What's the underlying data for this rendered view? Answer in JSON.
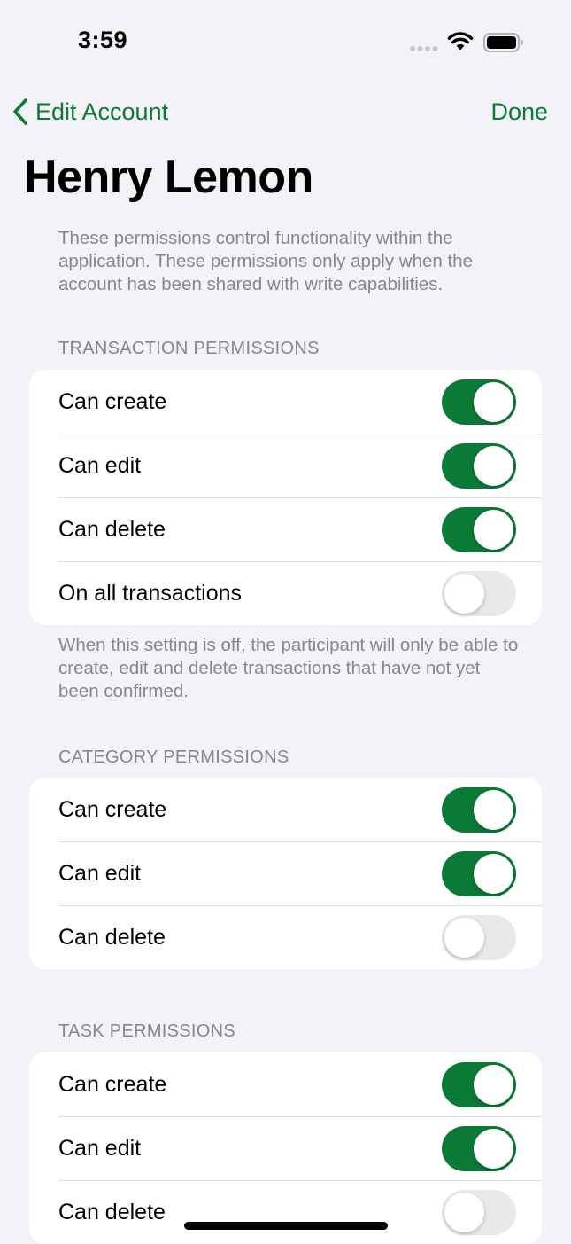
{
  "status_bar": {
    "time": "3:59",
    "icons": [
      "cellular-signal-icon",
      "wifi-icon",
      "battery-icon"
    ]
  },
  "nav": {
    "back_label": "Edit Account",
    "back_icon": "chevron-left-icon",
    "done_label": "Done",
    "accent_color": "#0b7a36"
  },
  "page": {
    "title": "Henry Lemon",
    "intro": "These permissions control functionality within the application. These permissions only apply when the account has been shared with write capabilities."
  },
  "sections": {
    "transaction": {
      "header": "TRANSACTION PERMISSIONS",
      "rows": [
        {
          "label": "Can create",
          "on": true
        },
        {
          "label": "Can edit",
          "on": true
        },
        {
          "label": "Can delete",
          "on": true
        },
        {
          "label": "On all transactions",
          "on": false
        }
      ],
      "footer": "When this setting is off, the participant will only be able to create, edit and delete transactions that have not yet been confirmed."
    },
    "category": {
      "header": "CATEGORY PERMISSIONS",
      "rows": [
        {
          "label": "Can create",
          "on": true
        },
        {
          "label": "Can edit",
          "on": true
        },
        {
          "label": "Can delete",
          "on": false
        }
      ]
    },
    "task": {
      "header": "TASK PERMISSIONS",
      "rows": [
        {
          "label": "Can create",
          "on": true
        },
        {
          "label": "Can edit",
          "on": true
        },
        {
          "label": "Can delete",
          "on": false
        }
      ]
    }
  }
}
